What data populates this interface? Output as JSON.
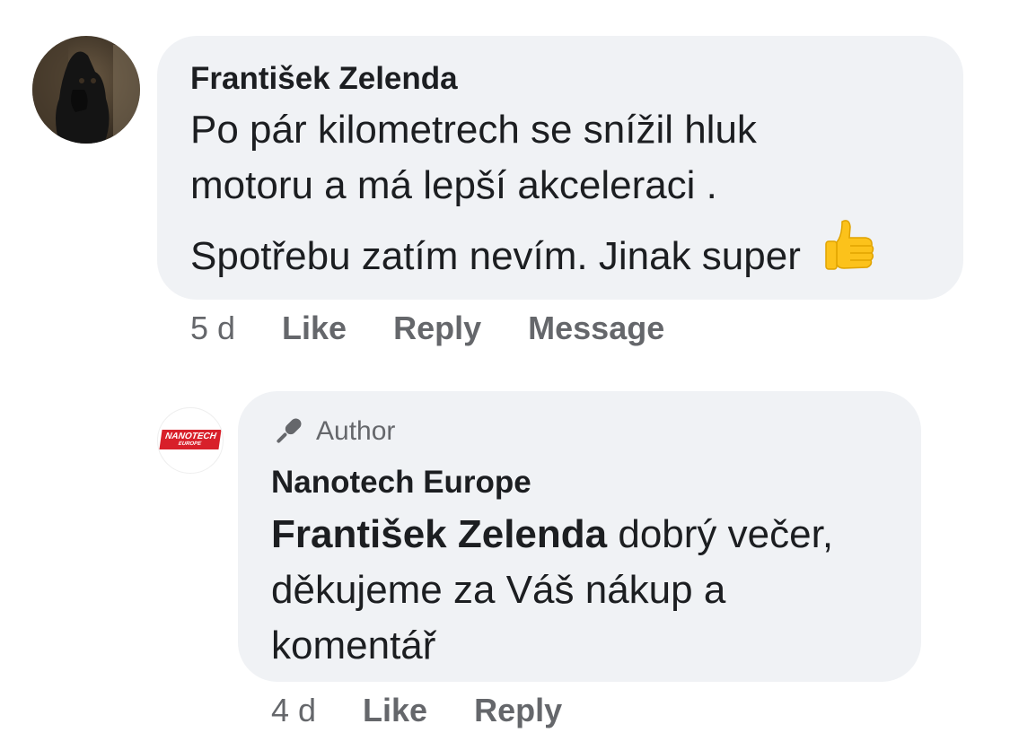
{
  "comment": {
    "author": "František Zelenda",
    "lines": [
      "Po pár kilometrech se snížil hluk",
      "motoru a má lepší akceleraci ."
    ],
    "second_paragraph": "Spotřebu zatím nevím. Jinak super",
    "emoji": "thumbs-up-emoji",
    "avatar_icon": "dog-avatar",
    "time": "5 d",
    "actions": {
      "like": "Like",
      "reply": "Reply",
      "message": "Message"
    }
  },
  "reply": {
    "badge": "Author",
    "badge_icon": "microphone-icon",
    "author": "Nanotech Europe",
    "logo": {
      "line1": "NANOTECH",
      "line2": "EUROPE"
    },
    "mention": "František Zelenda",
    "lines_rest": " dobrý večer,",
    "line2": "děkujeme za Váš nákup a",
    "line3": "komentář",
    "time": "4 d",
    "actions": {
      "like": "Like",
      "reply": "Reply"
    }
  },
  "colors": {
    "bubble": "#f0f2f5",
    "muted": "#65676b",
    "logo_red": "#d8202a"
  }
}
